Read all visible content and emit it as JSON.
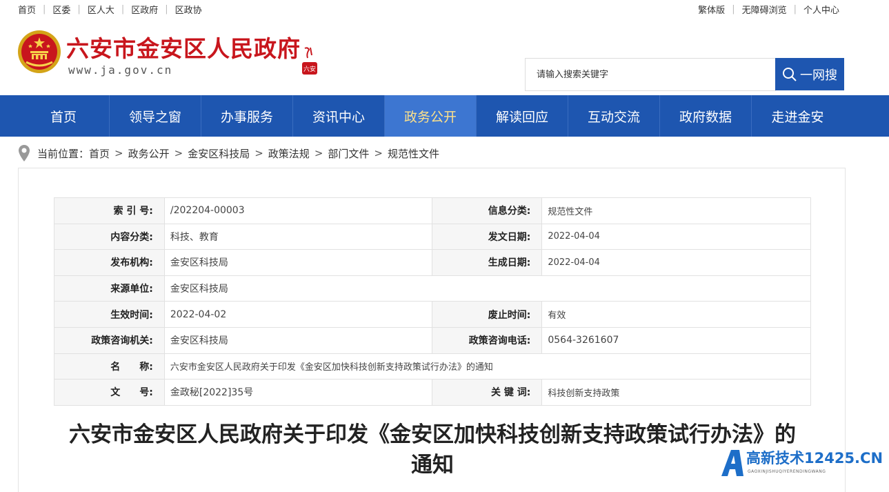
{
  "topbar": {
    "left_links": [
      "首页",
      "区委",
      "区人大",
      "区政府",
      "区政协"
    ],
    "right_links": [
      "繁体版",
      "无障碍浏览",
      "个人中心"
    ]
  },
  "header": {
    "title": "六安市金安区人民政府",
    "url": "www.ja.gov.cn",
    "seal_text": "六安",
    "search_placeholder": "请输入搜索关键字",
    "search_button": "一网搜"
  },
  "nav": {
    "items": [
      "首页",
      "领导之窗",
      "办事服务",
      "资讯中心",
      "政务公开",
      "解读回应",
      "互动交流",
      "政府数据",
      "走进金安"
    ],
    "active": "政务公开"
  },
  "breadcrumb": {
    "label": "当前位置：",
    "items": [
      "首页",
      "政务公开",
      "金安区科技局",
      "政策法规",
      "部门文件",
      "规范性文件"
    ],
    "separator": ">"
  },
  "meta": {
    "index_label": "索 引 号:",
    "index_value": "/202204-00003",
    "info_cat_label": "信息分类:",
    "info_cat_value": "规范性文件",
    "content_cat_label": "内容分类:",
    "content_cat_value": "科技、教育",
    "issue_date_label": "发文日期:",
    "issue_date_value": "2022-04-04",
    "publisher_label": "发布机构:",
    "publisher_value": "金安区科技局",
    "gen_date_label": "生成日期:",
    "gen_date_value": "2022-04-04",
    "source_label": "来源单位:",
    "source_value": "金安区科技局",
    "effective_label": "生效时间:",
    "effective_value": "2022-04-02",
    "abolish_label": "废止时间:",
    "abolish_value": "有效",
    "consult_org_label": "政策咨询机关:",
    "consult_org_value": "金安区科技局",
    "consult_tel_label": "政策咨询电话:",
    "consult_tel_value": "0564-3261607",
    "name_label": "名　　称:",
    "name_value": "六安市金安区人民政府关于印发《金安区加快科技创新支持政策试行办法》的通知",
    "docno_label": "文　　号:",
    "docno_value": "金政秘[2022]35号",
    "keyword_label": "关 键 词:",
    "keyword_value": "科技创新支持政策"
  },
  "doc": {
    "title_line1": "六安市金安区人民政府关于印发《金安区加快科技创新支持政策试行办法》的",
    "title_line2": "通知"
  },
  "watermark": {
    "text": "高新技术12425.CN",
    "sub": "GAOXINJISHUQIYERENDINGWANG"
  },
  "colors": {
    "nav_bg": "#1e56b0",
    "nav_active": "#3d76d1",
    "title_red": "#c8161d",
    "active_text": "#ffe28a"
  }
}
